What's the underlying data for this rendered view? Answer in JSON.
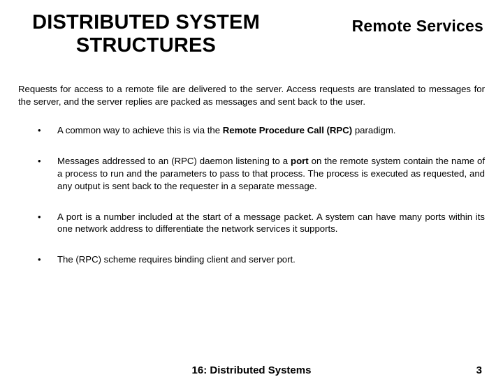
{
  "header": {
    "title_line1": "DISTRIBUTED SYSTEM",
    "title_line2": "STRUCTURES",
    "subtitle": "Remote Services"
  },
  "intro": "Requests for access to a remote file are delivered to the server.  Access requests are translated to messages for the server, and the server replies are packed as messages and sent back to the user.",
  "bullets": [
    {
      "pre": "A common way to achieve this is via the ",
      "bold1": "Remote Procedure Call  (RPC)",
      "post1": " paradigm."
    },
    {
      "pre": "Messages addressed to an (RPC) daemon listening to a ",
      "bold1": "port",
      "post1": " on the remote system contain the name of a process to run and the parameters to pass to that process.  The process is executed as requested, and any output is sent back to the requester in a separate message."
    },
    {
      "pre": "A port is a number included at the start of a message packet.  A system can have many ports within its one network address to differentiate the network services it supports."
    },
    {
      "pre": "The  (RPC) scheme requires binding client and server port."
    }
  ],
  "footer": {
    "label": "16: Distributed Systems",
    "page": "3"
  }
}
